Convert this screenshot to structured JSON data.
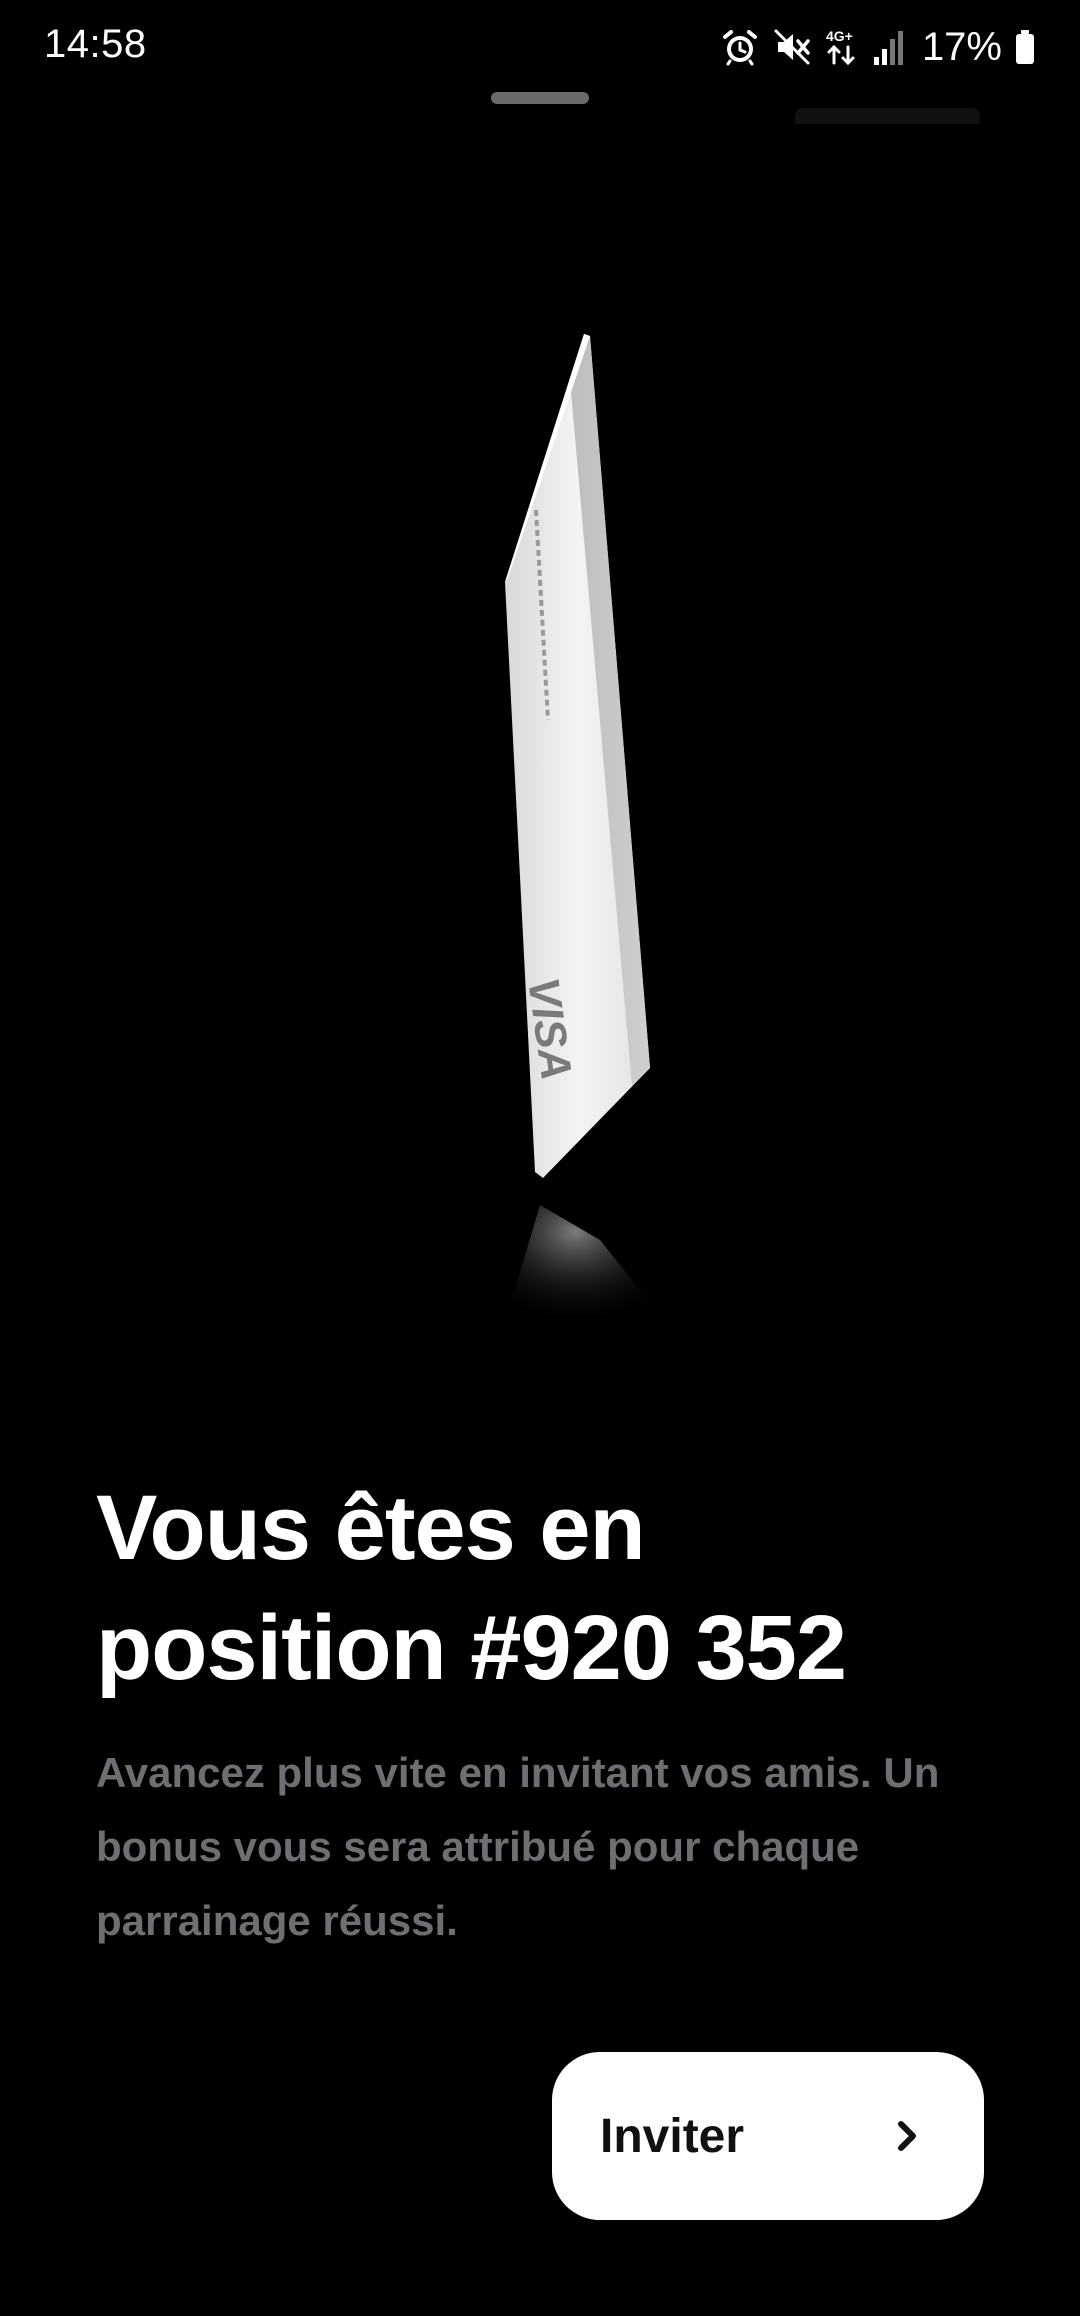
{
  "status_bar": {
    "time": "14:58",
    "battery_percent": "17%",
    "network_label": "4G+",
    "icons": [
      "alarm-icon",
      "mute-icon",
      "network-4g-icon",
      "signal-icon",
      "battery-icon"
    ]
  },
  "card": {
    "brand": "VISA",
    "card_color": "#e6e6e6",
    "background_color": "#000000"
  },
  "main": {
    "headline_line1": "Vous êtes en",
    "headline_line2": "position #920 352",
    "description_line1": "Avancez plus vite en invitant vos amis. Un",
    "description_line2": "bonus vous sera attribué pour chaque",
    "description_line3": "parrainage réussi."
  },
  "invite_button": {
    "label": "Inviter",
    "icon": "chevron-right-icon"
  }
}
